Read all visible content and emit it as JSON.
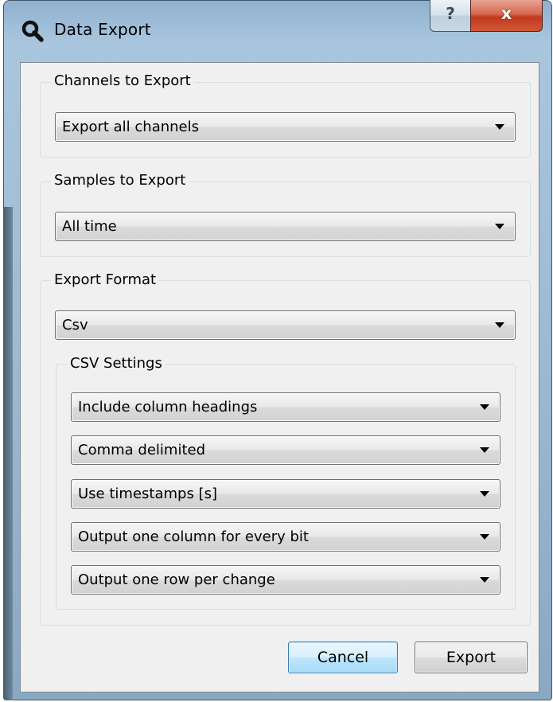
{
  "window": {
    "title": "Data Export",
    "help_label": "?",
    "close_label": "x"
  },
  "channels": {
    "title": "Channels to Export",
    "selected": "Export all channels"
  },
  "samples": {
    "title": "Samples to Export",
    "selected": "All time"
  },
  "format": {
    "title": "Export Format",
    "selected": "Csv",
    "csv": {
      "title": "CSV Settings",
      "headings": "Include column headings",
      "delimiter": "Comma delimited",
      "timestamps": "Use timestamps [s]",
      "bit_columns": "Output one column for every bit",
      "row_mode": "Output one row per change"
    }
  },
  "buttons": {
    "cancel": "Cancel",
    "export": "Export"
  },
  "colors": {
    "close_button": "#c2391d",
    "default_button": "#bee6fd",
    "dialog_background": "#f0f0f0"
  },
  "icons": {
    "title": "magnifier-icon",
    "dropdown": "chevron-down-icon"
  }
}
